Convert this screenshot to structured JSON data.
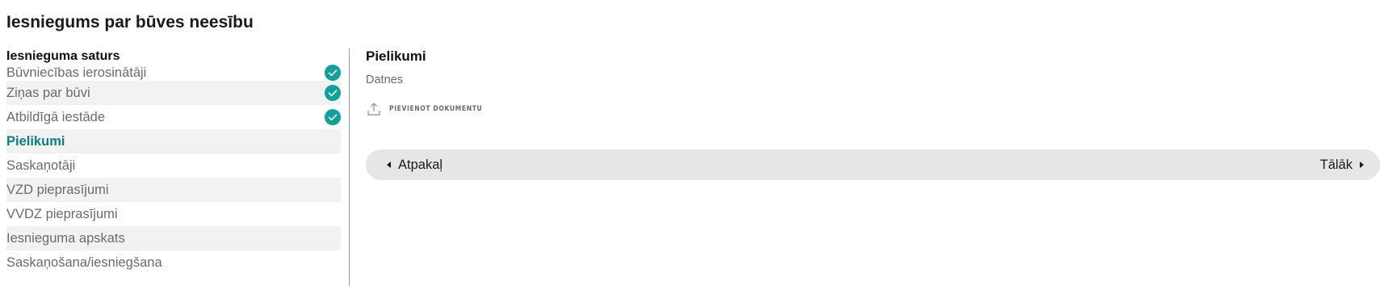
{
  "page": {
    "title": "Iesniegums par būves neesību"
  },
  "sidebar": {
    "heading": "Iesnieguma saturs",
    "items": [
      {
        "label": "Būvniecības ierosinātāji",
        "completed": true
      },
      {
        "label": "Ziņas par būvi",
        "completed": true
      },
      {
        "label": "Atbildīgā iestāde",
        "completed": true
      },
      {
        "label": "Pielikumi",
        "completed": false,
        "active": true
      },
      {
        "label": "Saskaņotāji",
        "completed": false
      },
      {
        "label": "VZD pieprasījumi",
        "completed": false
      },
      {
        "label": "VVDZ pieprasījumi",
        "completed": false
      },
      {
        "label": "Iesnieguma apskats",
        "completed": false
      },
      {
        "label": "Saskaņošana/iesniegšana",
        "completed": false
      }
    ]
  },
  "main": {
    "section_title": "Pielikumi",
    "subsection_label": "Datnes",
    "add_document_label": "PIEVIENOT DOKUMENTU",
    "add_document_icon": "upload-icon"
  },
  "navigation": {
    "back_label": "Atpakaļ",
    "back_icon": "triangle-left-icon",
    "next_label": "Tālāk",
    "next_icon": "triangle-right-icon"
  },
  "colors": {
    "accent": "#0d7f7f",
    "check_badge": "#12a19a",
    "row_shade": "#f2f2f2",
    "nav_bar": "#e6e6e6"
  }
}
